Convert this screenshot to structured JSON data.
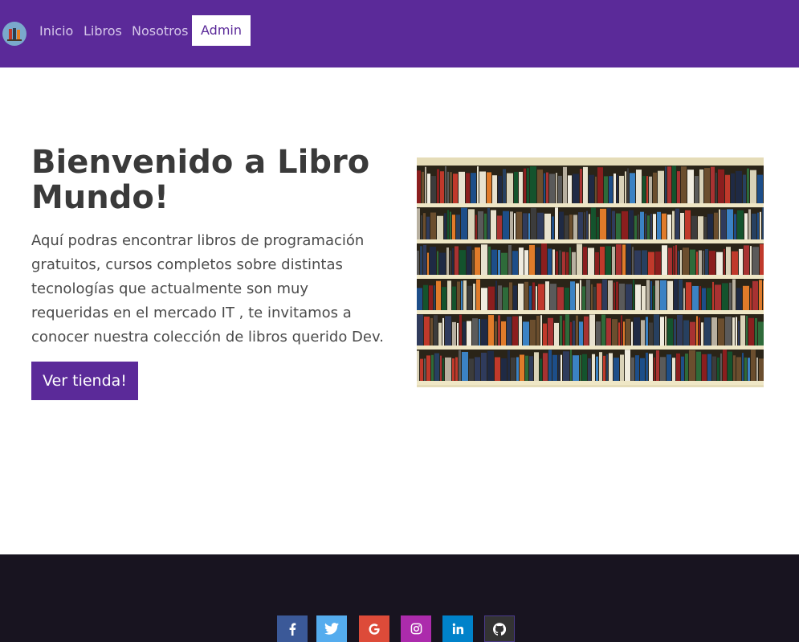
{
  "nav": {
    "links": [
      "Inicio",
      "Libros",
      "Nosotros"
    ],
    "admin_label": "Admin"
  },
  "hero": {
    "title": "Bienvenido a Libro Mundo!",
    "description": "Aquí podras encontrar libros de programación gratuitos, cursos completos sobre distintas tecnologías que actualmente son muy requeridas en el mercado IT , te invitamos a conocer nuestra colección de libros querido Dev.",
    "button_label": "Ver tienda!"
  },
  "footer": {
    "social_icons": [
      "facebook-icon",
      "twitter-icon",
      "google-icon",
      "instagram-icon",
      "linkedin-icon",
      "github-icon"
    ]
  },
  "colors": {
    "brand_purple": "#5b2a99",
    "footer_bg": "#181420",
    "facebook": "#3b5998",
    "twitter": "#55acee",
    "google": "#dd4b39",
    "instagram": "#ac2bac",
    "linkedin": "#0082ca",
    "github": "#333333"
  }
}
